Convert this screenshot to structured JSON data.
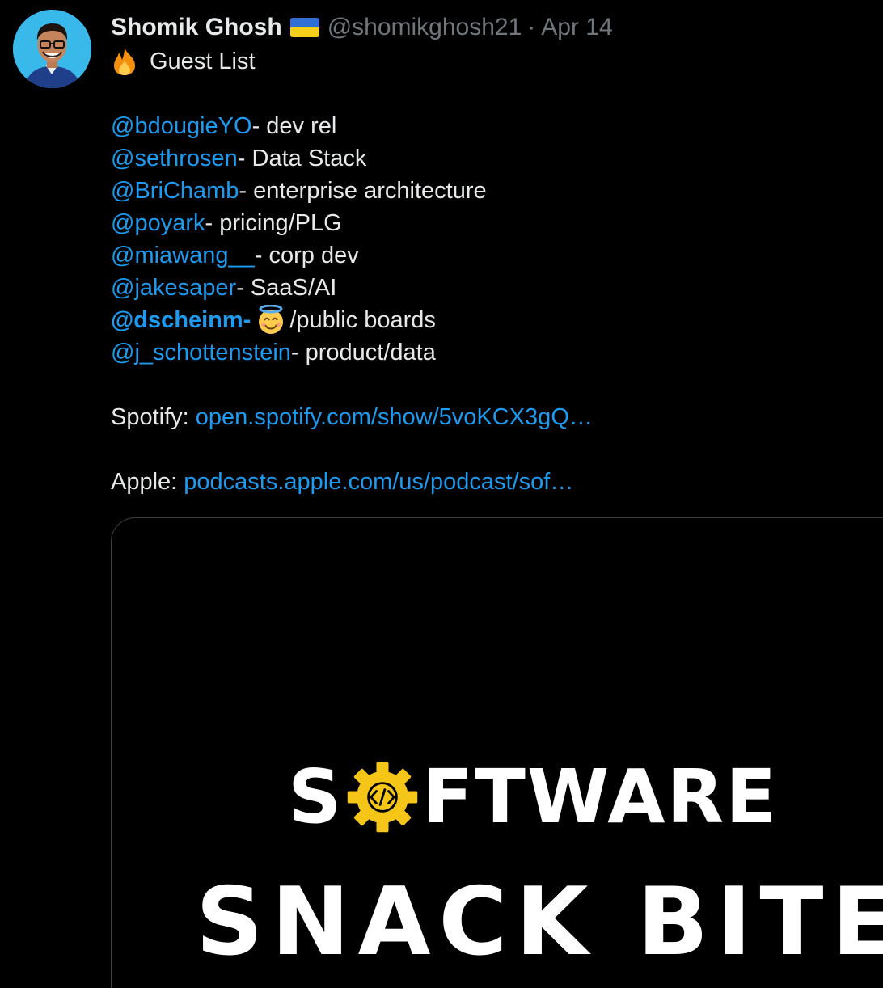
{
  "author": {
    "display_name": "Shomik Ghosh",
    "flag_icon": "ukraine-flag-icon",
    "handle": "@shomikghosh21",
    "separator": "·",
    "date": "Apr 14"
  },
  "tweet": {
    "title_emoji": "fire-icon",
    "title": "Guest List",
    "guests": [
      {
        "handle": "@bdougieYO",
        "topic": "- dev rel"
      },
      {
        "handle": "@sethrosen",
        "topic": "- Data Stack"
      },
      {
        "handle": "@BriChamb",
        "topic": "- enterprise architecture"
      },
      {
        "handle": "@poyark",
        "topic": "- pricing/PLG"
      },
      {
        "handle": "@miawang__",
        "topic": "- corp dev"
      },
      {
        "handle": "@jakesaper",
        "topic": "- SaaS/AI"
      },
      {
        "handle": "@dscheinm",
        "topic_prefix": "- ",
        "emoji": "smiling-face-with-halo-icon",
        "topic": "/public boards"
      },
      {
        "handle": "@j_schottenstein",
        "topic": "- product/data"
      }
    ],
    "spotify": {
      "label": "Spotify:",
      "url": "open.spotify.com/show/5voKCX3gQ…"
    },
    "apple": {
      "label": "Apple:",
      "url": "podcasts.apple.com/us/podcast/sof…"
    }
  },
  "media": {
    "logo_line1_prefix": "S",
    "logo_gear_icon": "gear-code-icon",
    "logo_line1_suffix": "FTWARE",
    "logo_line2": "SNACK BITES"
  },
  "colors": {
    "background": "#000000",
    "text": "#e7e9ea",
    "muted": "#71767b",
    "link": "#1d9bf0",
    "gear": "#f5c518"
  }
}
